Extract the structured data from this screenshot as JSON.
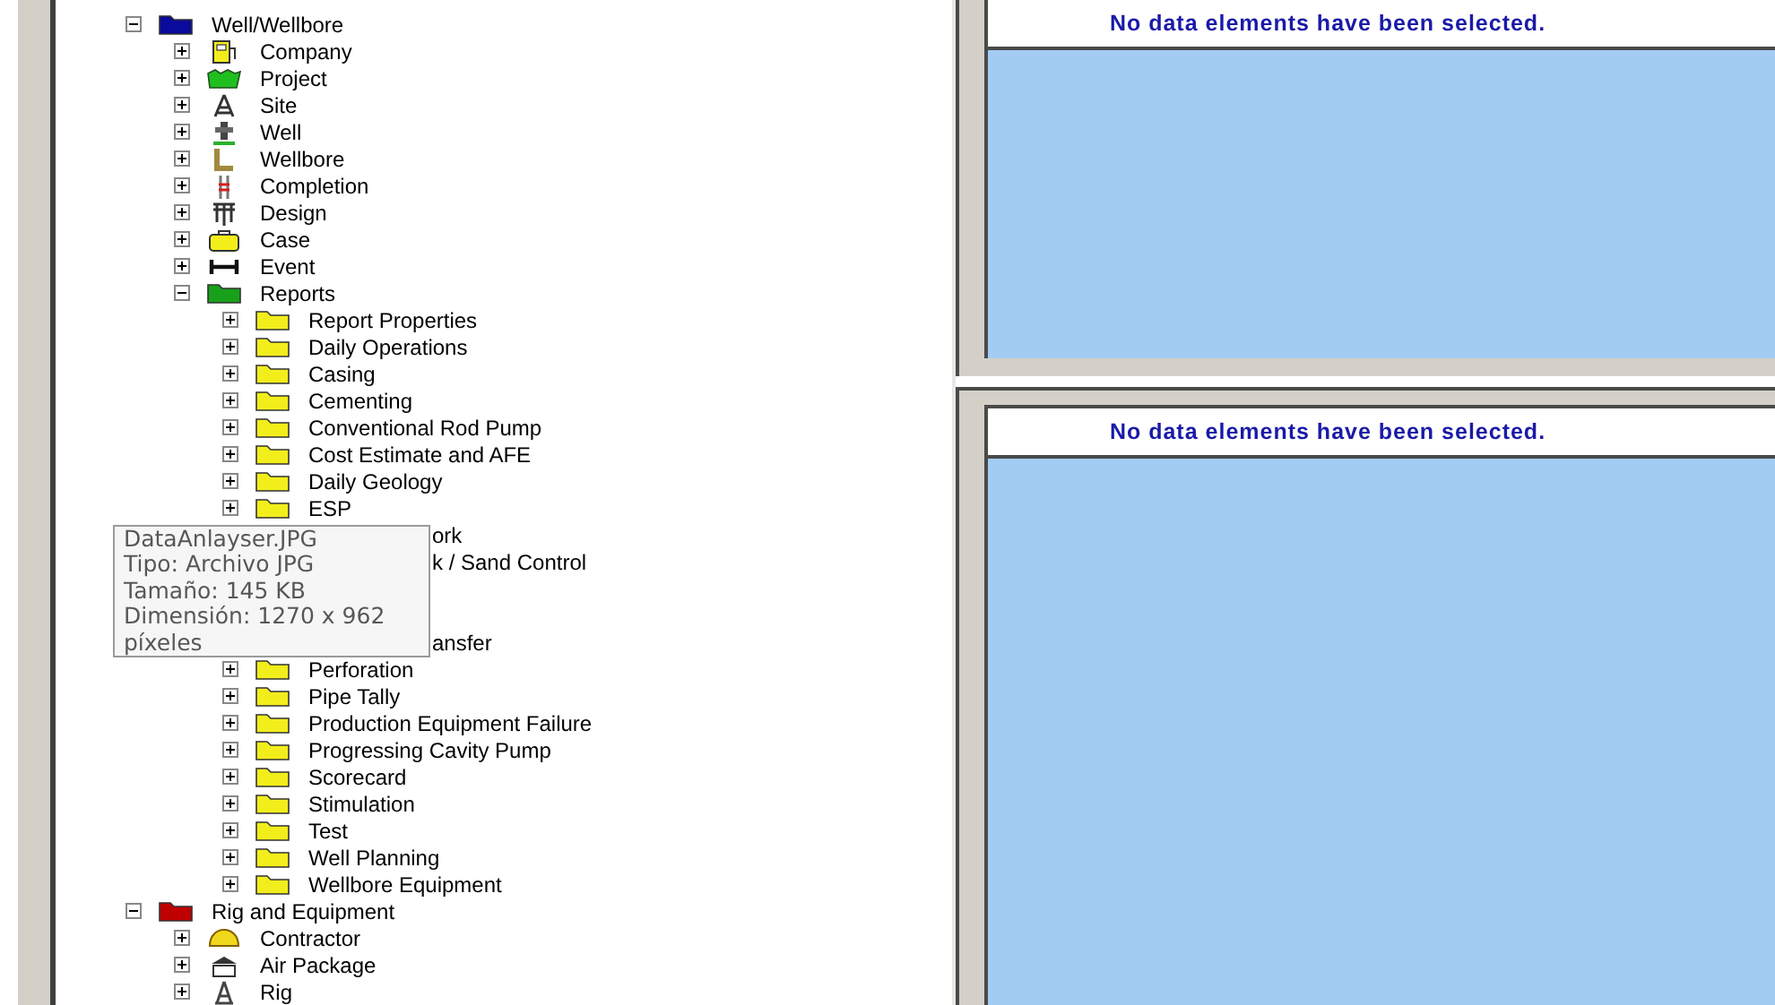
{
  "tree": [
    {
      "label": "Well/Wellbore",
      "kind": "folder",
      "color": "#0a0a9c",
      "expanded": true,
      "children": [
        {
          "label": "Company",
          "kind": "company",
          "expanded": false
        },
        {
          "label": "Project",
          "kind": "project",
          "expanded": false
        },
        {
          "label": "Site",
          "kind": "site",
          "expanded": false
        },
        {
          "label": "Well",
          "kind": "well",
          "expanded": false
        },
        {
          "label": "Wellbore",
          "kind": "wellbore",
          "expanded": false
        },
        {
          "label": "Completion",
          "kind": "completion",
          "expanded": false
        },
        {
          "label": "Design",
          "kind": "design",
          "expanded": false
        },
        {
          "label": "Case",
          "kind": "case",
          "expanded": false
        },
        {
          "label": "Event",
          "kind": "event",
          "expanded": false
        },
        {
          "label": "Reports",
          "kind": "folder",
          "color": "#17a01a",
          "expanded": true,
          "children": [
            {
              "label": "Report Properties",
              "kind": "folder",
              "color": "#f2ee1c",
              "expanded": false
            },
            {
              "label": "Daily Operations",
              "kind": "folder",
              "color": "#f2ee1c",
              "expanded": false
            },
            {
              "label": "Casing",
              "kind": "folder",
              "color": "#f2ee1c",
              "expanded": false
            },
            {
              "label": "Cementing",
              "kind": "folder",
              "color": "#f2ee1c",
              "expanded": false
            },
            {
              "label": "Conventional Rod Pump",
              "kind": "folder",
              "color": "#f2ee1c",
              "expanded": false
            },
            {
              "label": "Cost Estimate and AFE",
              "kind": "folder",
              "color": "#f2ee1c",
              "expanded": false
            },
            {
              "label": "Daily Geology",
              "kind": "folder",
              "color": "#f2ee1c",
              "expanded": false
            },
            {
              "label": "ESP",
              "kind": "folder",
              "color": "#f2ee1c",
              "expanded": false
            },
            {
              "label": "ork",
              "kind": "covered"
            },
            {
              "label": "k / Sand Control",
              "kind": "covered"
            },
            {
              "kind": "hidden"
            },
            {
              "kind": "hidden"
            },
            {
              "label": "ansfer",
              "kind": "covered"
            },
            {
              "label": "Perforation",
              "kind": "folder",
              "color": "#f2ee1c",
              "expanded": false
            },
            {
              "label": "Pipe Tally",
              "kind": "folder",
              "color": "#f2ee1c",
              "expanded": false
            },
            {
              "label": "Production Equipment Failure",
              "kind": "folder",
              "color": "#f2ee1c",
              "expanded": false
            },
            {
              "label": "Progressing Cavity Pump",
              "kind": "folder",
              "color": "#f2ee1c",
              "expanded": false
            },
            {
              "label": "Scorecard",
              "kind": "folder",
              "color": "#f2ee1c",
              "expanded": false
            },
            {
              "label": "Stimulation",
              "kind": "folder",
              "color": "#f2ee1c",
              "expanded": false
            },
            {
              "label": "Test",
              "kind": "folder",
              "color": "#f2ee1c",
              "expanded": false
            },
            {
              "label": "Well Planning",
              "kind": "folder",
              "color": "#f2ee1c",
              "expanded": false
            },
            {
              "label": "Wellbore Equipment",
              "kind": "folder",
              "color": "#f2ee1c",
              "expanded": false
            }
          ]
        }
      ]
    },
    {
      "label": "Rig and Equipment",
      "kind": "folder",
      "color": "#c00000",
      "expanded": true,
      "children": [
        {
          "label": "Contractor",
          "kind": "contractor",
          "expanded": false
        },
        {
          "label": "Air Package",
          "kind": "air-package",
          "expanded": false
        },
        {
          "label": "Rig",
          "kind": "rig",
          "expanded": false
        }
      ]
    }
  ],
  "tooltip": {
    "lines": [
      "DataAnlayser.JPG",
      "Tipo: Archivo JPG",
      "Tamaño: 145 KB",
      "Dimensión: 1270 x 962 píxeles"
    ]
  },
  "panels": [
    {
      "message": "No data elements have been selected."
    },
    {
      "message": "No data elements have been selected."
    }
  ]
}
